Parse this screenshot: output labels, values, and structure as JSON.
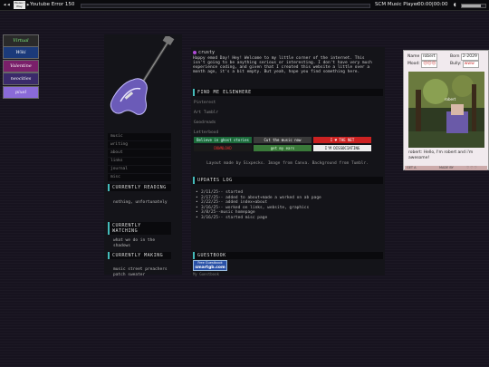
{
  "player": {
    "prev_icon": "skip-back-icon",
    "next_icon": "skip-forward-icon",
    "now_playing_btn": "Pause / Play",
    "track": "Youtube Error 150",
    "progress": 0.0,
    "name": "SCM Music Player",
    "time": "00:00|00:00",
    "volume": 0.8
  },
  "left_buttons": [
    {
      "label": "Virtual",
      "bg": "#2a2a2a",
      "fg": "#7ef07e"
    },
    {
      "label": "Wiki",
      "bg": "#1b3a7a",
      "fg": "#ffffff"
    },
    {
      "label": "Valentine",
      "bg": "#7a1f6a",
      "fg": "#ffffff"
    },
    {
      "label": "neocities",
      "bg": "#3a2a6a",
      "fg": "#ffffff"
    },
    {
      "label": "pixel",
      "bg": "#8a6ad8",
      "fg": "#ffffff"
    }
  ],
  "nav": [
    "music",
    "writing",
    "about",
    "links",
    "journal",
    "misc"
  ],
  "sections": {
    "reading": {
      "title": "CURRENTLY READING",
      "body": "nothing, unfortunately"
    },
    "watching": {
      "title": "CURRENTLY WATCHING",
      "body": "what we do in the shadows"
    },
    "making": {
      "title": "CURRENTLY MAKING",
      "body": "music street preachers patch sweater"
    }
  },
  "intro": {
    "name": "crusty",
    "text": "Happy emod Day! Hey! Welcome to my little corner of the internet. This isn't going to be anything serious or interesting. I don't have very much experience coding, and given that I created this website a little over a month ago, it's a bit empty. But yeah, hope you find something here."
  },
  "elsewhere": {
    "title": "FIND ME ELSEWHERE",
    "links": [
      "Pinterest",
      "Art Tumblr",
      "Goodreads",
      "Letterboxd"
    ]
  },
  "badges": [
    {
      "label": "Believe in ghost stories",
      "bg": "#1c6a3a",
      "fg": "#dff"
    },
    {
      "label": "Cut the music now",
      "bg": "#3a3a3a",
      "fg": "#fff"
    },
    {
      "label": "I ♥ THE NET",
      "bg": "#c22",
      "fg": "#fff"
    },
    {
      "label": "DOWNLOAD",
      "bg": "#1a1a1a",
      "fg": "#e33"
    },
    {
      "label": "get my ears",
      "bg": "#3a7a3a",
      "fg": "#dfd"
    },
    {
      "label": "I'M DISSOCIATING",
      "bg": "#eeeeee",
      "fg": "#000"
    }
  ],
  "credit": "Layout made by Sixpecks. Image from Canva. Background from Tumblr.",
  "updates": {
    "title": "UPDATES LOG",
    "items": [
      "2/11/25-- started",
      "2/17/25-- added to about+made a worked on ab page",
      "2/22/25-- added index+about",
      "3/16/25-- worked on links, website, graphics",
      "3/8/25--music homepage",
      "3/16/25-- started misc page"
    ]
  },
  "guestbook": {
    "title": "GUESTBOOK",
    "btn_line1": "Free Guestbook",
    "btn_line2": "smartgb.com",
    "sub": "My Guestbook"
  },
  "card": {
    "name_label": "Name",
    "name": "robert",
    "born_label": "Born",
    "born": "2-2029",
    "mood_label": "Mood:",
    "mood": "☹☹☹",
    "bully_label": "Bully:",
    "bully": "www",
    "photo_caption": "robert",
    "speech": "robert: Hello, I'm robert and i'm awesome!",
    "foot_left": "GET A",
    "foot_mid": "MADE BY",
    "foot_right": "♡ ♡ ♡"
  },
  "colors": {
    "accent_teal": "#44bbbb",
    "accent_purple": "#b04bd8",
    "background": "#17131f",
    "panel": "#141419"
  }
}
